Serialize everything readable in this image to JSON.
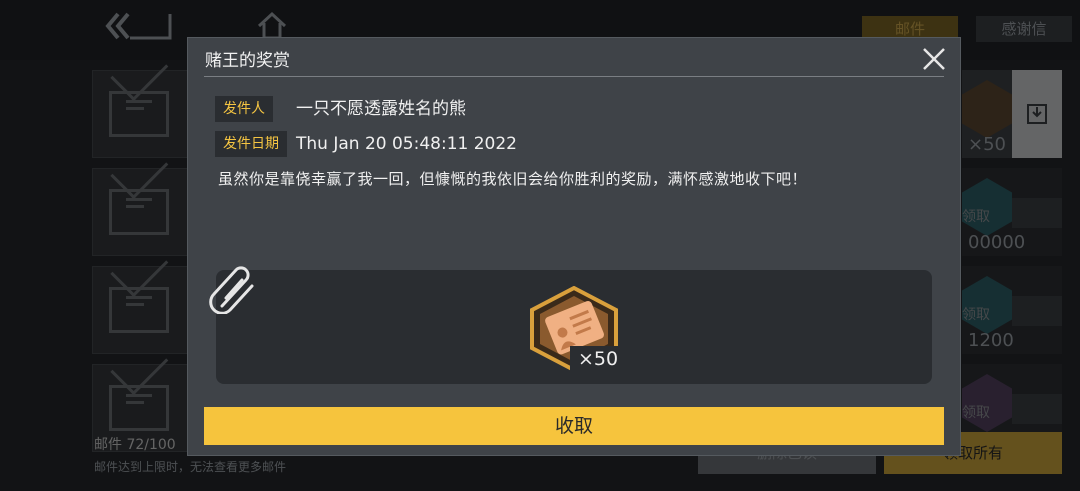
{
  "background": {
    "tabs": [
      {
        "label": "邮件"
      },
      {
        "label": "感谢信"
      }
    ],
    "mail_count": "邮件 72/100",
    "mail_limit_note": "邮件达到上限时，无法查看更多邮件",
    "reward_slots": [
      {
        "count": "×50",
        "claim": ""
      },
      {
        "count": "00000",
        "claim": "领取"
      },
      {
        "count": "1200",
        "claim": "领取"
      },
      {
        "count": "",
        "claim": "领取"
      }
    ],
    "buttons": {
      "delete_read": "删除已读",
      "claim_all": "领取所有"
    }
  },
  "modal": {
    "title": "赌王的奖赏",
    "sender_label": "发件人",
    "sender_value": "一只不愿透露姓名的熊",
    "date_label": "发件日期",
    "date_value": "Thu Jan 20 05:48:11 2022",
    "body": "虽然你是靠侥幸赢了我一回，但慷慨的我依旧会给你胜利的奖励，满怀感激地收下吧！",
    "attachments": [
      {
        "icon": "id-card-icon",
        "count": "×50"
      }
    ],
    "claim_button": "收取"
  },
  "colors": {
    "accent_yellow": "#f6c43d",
    "label_yellow": "#f5c542",
    "modal_bg": "#3f4348",
    "panel_bg": "#2a2d31",
    "item_orange": "#e89858"
  }
}
